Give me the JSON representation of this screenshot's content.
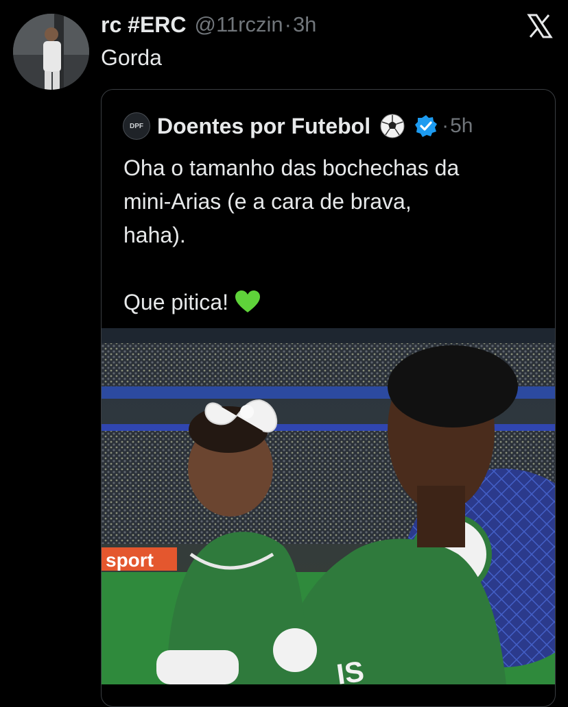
{
  "tweet": {
    "author_name": "rc #ERC",
    "handle": "@11rczin",
    "separator": "·",
    "time": "3h",
    "text": "Gorda"
  },
  "quoted_tweet": {
    "author_name": "Doentes por Futebol",
    "separator": "·",
    "time": "5h",
    "text_lines": [
      "Oha o tamanho das bochechas da",
      "mini-Arias (e a cara de brava,",
      "haha).",
      "Que pitica!"
    ],
    "media_board_text": "sport",
    "avatar_text": "DPF"
  },
  "icons": {
    "close": "x-logo-icon",
    "emoji_ball": "soccer-ball-icon",
    "verified": "verified-badge-icon",
    "emoji_heart": "green-heart-icon"
  },
  "colors": {
    "background": "#000000",
    "primary_text": "#e7e9ea",
    "secondary_text": "#71767b",
    "verified_blue": "#1d9bf0",
    "heart_green": "#5fd33a",
    "jersey_green": "#2f7a3c"
  }
}
